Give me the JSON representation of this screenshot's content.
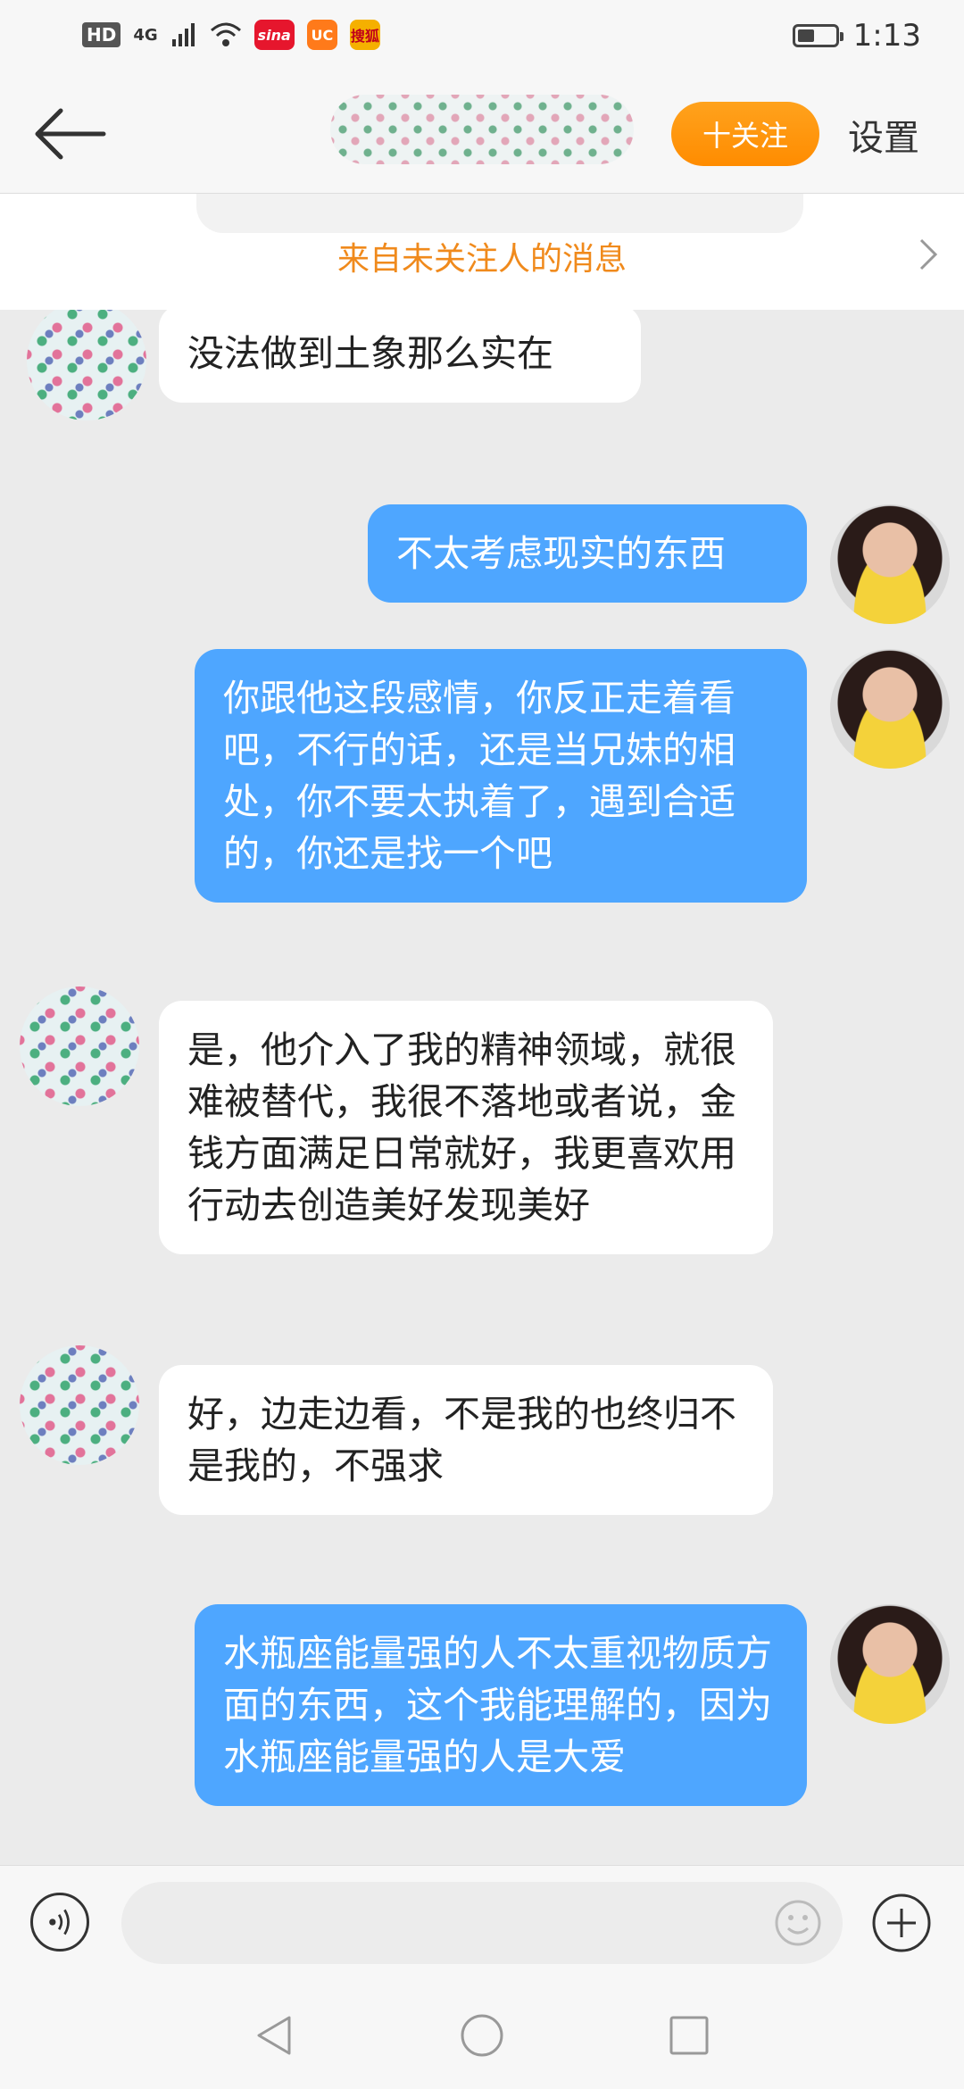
{
  "status_bar": {
    "left_badges": [
      "HD",
      "4G"
    ],
    "apps": [
      {
        "name": "sina-weibo",
        "label": "sina",
        "color": "#e6162d"
      },
      {
        "name": "uc-browser",
        "label": "UC",
        "color": "#ff7a1a"
      },
      {
        "name": "sohu-video",
        "label": "搜狐",
        "color": "#f5b000"
      }
    ],
    "time": "1:13",
    "battery_level": 0.45
  },
  "header": {
    "follow_label": "十关注",
    "settings_label": "设置"
  },
  "notice": {
    "text": "来自未关注人的消息"
  },
  "messages": [
    {
      "side": "in",
      "text": "没法做到土象那么实在"
    },
    {
      "side": "out",
      "text": "不太考虑现实的东西"
    },
    {
      "side": "out",
      "text": "你跟他这段感情，你反正走着看吧，不行的话，还是当兄妹的相处，你不要太执着了，遇到合适的，你还是找一个吧"
    },
    {
      "side": "in",
      "text": "是，他介入了我的精神领域，就很难被替代，我很不落地或者说，金钱方面满足日常就好，我更喜欢用行动去创造美好发现美好"
    },
    {
      "side": "in",
      "text": "好，边走边看，不是我的也终归不是我的，不强求"
    },
    {
      "side": "out",
      "text": "水瓶座能量强的人不太重视物质方面的东西，这个我能理解的，因为水瓶座能量强的人是大爱"
    }
  ],
  "input": {
    "value": "",
    "placeholder": ""
  },
  "colors": {
    "accent_orange": "#ff9612",
    "bubble_out": "#4ea6ff",
    "notice_text": "#f08a1c"
  }
}
